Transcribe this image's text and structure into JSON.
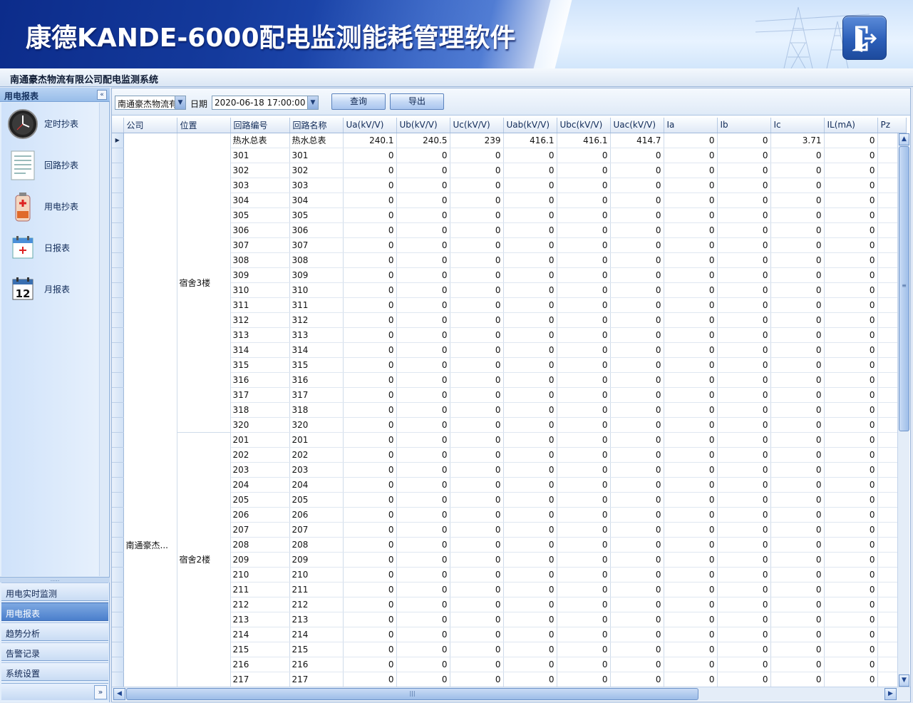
{
  "app": {
    "title": "康德KANDE-6000配电监测能耗管理软件",
    "subtitle": "南通豪杰物流有限公司配电监测系统"
  },
  "sidebar": {
    "header": "用电报表",
    "items": [
      {
        "label": "定时抄表",
        "icon": "clock-icon"
      },
      {
        "label": "回路抄表",
        "icon": "document-icon"
      },
      {
        "label": "用电抄表",
        "icon": "battery-icon"
      },
      {
        "label": "日报表",
        "icon": "calendar-day-icon"
      },
      {
        "label": "月报表",
        "icon": "calendar-month-icon"
      }
    ],
    "nav": [
      "用电实时监测",
      "用电报表",
      "趋势分析",
      "告警记录",
      "系统设置"
    ],
    "active_nav": "用电报表"
  },
  "toolbar": {
    "company_value": "南通豪杰物流有",
    "date_label": "日期",
    "date_value": "2020-06-18 17:00:00",
    "query_label": "查询",
    "export_label": "导出"
  },
  "table": {
    "columns": [
      "公司",
      "位置",
      "回路编号",
      "回路名称",
      "Ua(kV/V)",
      "Ub(kV/V)",
      "Uc(kV/V)",
      "Uab(kV/V)",
      "Ubc(kV/V)",
      "Uac(kV/V)",
      "Ia",
      "Ib",
      "Ic",
      "IL(mA)",
      "Pz"
    ],
    "company": "南通豪杰...",
    "groups": [
      {
        "location": "宿舍3楼",
        "rows": [
          {
            "no": "热水总表",
            "name": "热水总表",
            "values": [
              "240.1",
              "240.5",
              "239",
              "416.1",
              "416.1",
              "414.7",
              "0",
              "0",
              "3.71",
              "0",
              ""
            ]
          },
          {
            "no": "301",
            "name": "301",
            "values": [
              "0",
              "0",
              "0",
              "0",
              "0",
              "0",
              "0",
              "0",
              "0",
              "0",
              ""
            ]
          },
          {
            "no": "302",
            "name": "302",
            "values": [
              "0",
              "0",
              "0",
              "0",
              "0",
              "0",
              "0",
              "0",
              "0",
              "0",
              ""
            ]
          },
          {
            "no": "303",
            "name": "303",
            "values": [
              "0",
              "0",
              "0",
              "0",
              "0",
              "0",
              "0",
              "0",
              "0",
              "0",
              ""
            ]
          },
          {
            "no": "304",
            "name": "304",
            "values": [
              "0",
              "0",
              "0",
              "0",
              "0",
              "0",
              "0",
              "0",
              "0",
              "0",
              ""
            ]
          },
          {
            "no": "305",
            "name": "305",
            "values": [
              "0",
              "0",
              "0",
              "0",
              "0",
              "0",
              "0",
              "0",
              "0",
              "0",
              ""
            ]
          },
          {
            "no": "306",
            "name": "306",
            "values": [
              "0",
              "0",
              "0",
              "0",
              "0",
              "0",
              "0",
              "0",
              "0",
              "0",
              ""
            ]
          },
          {
            "no": "307",
            "name": "307",
            "values": [
              "0",
              "0",
              "0",
              "0",
              "0",
              "0",
              "0",
              "0",
              "0",
              "0",
              ""
            ]
          },
          {
            "no": "308",
            "name": "308",
            "values": [
              "0",
              "0",
              "0",
              "0",
              "0",
              "0",
              "0",
              "0",
              "0",
              "0",
              ""
            ]
          },
          {
            "no": "309",
            "name": "309",
            "values": [
              "0",
              "0",
              "0",
              "0",
              "0",
              "0",
              "0",
              "0",
              "0",
              "0",
              ""
            ]
          },
          {
            "no": "310",
            "name": "310",
            "values": [
              "0",
              "0",
              "0",
              "0",
              "0",
              "0",
              "0",
              "0",
              "0",
              "0",
              ""
            ]
          },
          {
            "no": "311",
            "name": "311",
            "values": [
              "0",
              "0",
              "0",
              "0",
              "0",
              "0",
              "0",
              "0",
              "0",
              "0",
              ""
            ]
          },
          {
            "no": "312",
            "name": "312",
            "values": [
              "0",
              "0",
              "0",
              "0",
              "0",
              "0",
              "0",
              "0",
              "0",
              "0",
              ""
            ]
          },
          {
            "no": "313",
            "name": "313",
            "values": [
              "0",
              "0",
              "0",
              "0",
              "0",
              "0",
              "0",
              "0",
              "0",
              "0",
              ""
            ]
          },
          {
            "no": "314",
            "name": "314",
            "values": [
              "0",
              "0",
              "0",
              "0",
              "0",
              "0",
              "0",
              "0",
              "0",
              "0",
              ""
            ]
          },
          {
            "no": "315",
            "name": "315",
            "values": [
              "0",
              "0",
              "0",
              "0",
              "0",
              "0",
              "0",
              "0",
              "0",
              "0",
              ""
            ]
          },
          {
            "no": "316",
            "name": "316",
            "values": [
              "0",
              "0",
              "0",
              "0",
              "0",
              "0",
              "0",
              "0",
              "0",
              "0",
              ""
            ]
          },
          {
            "no": "317",
            "name": "317",
            "values": [
              "0",
              "0",
              "0",
              "0",
              "0",
              "0",
              "0",
              "0",
              "0",
              "0",
              ""
            ]
          },
          {
            "no": "318",
            "name": "318",
            "values": [
              "0",
              "0",
              "0",
              "0",
              "0",
              "0",
              "0",
              "0",
              "0",
              "0",
              ""
            ]
          },
          {
            "no": "320",
            "name": "320",
            "values": [
              "0",
              "0",
              "0",
              "0",
              "0",
              "0",
              "0",
              "0",
              "0",
              "0",
              ""
            ]
          }
        ]
      },
      {
        "location": "宿舍2楼",
        "rows": [
          {
            "no": "201",
            "name": "201",
            "values": [
              "0",
              "0",
              "0",
              "0",
              "0",
              "0",
              "0",
              "0",
              "0",
              "0",
              ""
            ]
          },
          {
            "no": "202",
            "name": "202",
            "values": [
              "0",
              "0",
              "0",
              "0",
              "0",
              "0",
              "0",
              "0",
              "0",
              "0",
              ""
            ]
          },
          {
            "no": "203",
            "name": "203",
            "values": [
              "0",
              "0",
              "0",
              "0",
              "0",
              "0",
              "0",
              "0",
              "0",
              "0",
              ""
            ]
          },
          {
            "no": "204",
            "name": "204",
            "values": [
              "0",
              "0",
              "0",
              "0",
              "0",
              "0",
              "0",
              "0",
              "0",
              "0",
              ""
            ]
          },
          {
            "no": "205",
            "name": "205",
            "values": [
              "0",
              "0",
              "0",
              "0",
              "0",
              "0",
              "0",
              "0",
              "0",
              "0",
              ""
            ]
          },
          {
            "no": "206",
            "name": "206",
            "values": [
              "0",
              "0",
              "0",
              "0",
              "0",
              "0",
              "0",
              "0",
              "0",
              "0",
              ""
            ]
          },
          {
            "no": "207",
            "name": "207",
            "values": [
              "0",
              "0",
              "0",
              "0",
              "0",
              "0",
              "0",
              "0",
              "0",
              "0",
              ""
            ]
          },
          {
            "no": "208",
            "name": "208",
            "values": [
              "0",
              "0",
              "0",
              "0",
              "0",
              "0",
              "0",
              "0",
              "0",
              "0",
              ""
            ]
          },
          {
            "no": "209",
            "name": "209",
            "values": [
              "0",
              "0",
              "0",
              "0",
              "0",
              "0",
              "0",
              "0",
              "0",
              "0",
              ""
            ]
          },
          {
            "no": "210",
            "name": "210",
            "values": [
              "0",
              "0",
              "0",
              "0",
              "0",
              "0",
              "0",
              "0",
              "0",
              "0",
              ""
            ]
          },
          {
            "no": "211",
            "name": "211",
            "values": [
              "0",
              "0",
              "0",
              "0",
              "0",
              "0",
              "0",
              "0",
              "0",
              "0",
              ""
            ]
          },
          {
            "no": "212",
            "name": "212",
            "values": [
              "0",
              "0",
              "0",
              "0",
              "0",
              "0",
              "0",
              "0",
              "0",
              "0",
              ""
            ]
          },
          {
            "no": "213",
            "name": "213",
            "values": [
              "0",
              "0",
              "0",
              "0",
              "0",
              "0",
              "0",
              "0",
              "0",
              "0",
              ""
            ]
          },
          {
            "no": "214",
            "name": "214",
            "values": [
              "0",
              "0",
              "0",
              "0",
              "0",
              "0",
              "0",
              "0",
              "0",
              "0",
              ""
            ]
          },
          {
            "no": "215",
            "name": "215",
            "values": [
              "0",
              "0",
              "0",
              "0",
              "0",
              "0",
              "0",
              "0",
              "0",
              "0",
              ""
            ]
          },
          {
            "no": "216",
            "name": "216",
            "values": [
              "0",
              "0",
              "0",
              "0",
              "0",
              "0",
              "0",
              "0",
              "0",
              "0",
              ""
            ]
          },
          {
            "no": "217",
            "name": "217",
            "values": [
              "0",
              "0",
              "0",
              "0",
              "0",
              "0",
              "0",
              "0",
              "0",
              "0",
              ""
            ]
          }
        ]
      }
    ]
  },
  "colors": {
    "banner_dark": "#0b2a88",
    "active_nav": "#4b7fcc",
    "panel": "#e3eefb"
  }
}
